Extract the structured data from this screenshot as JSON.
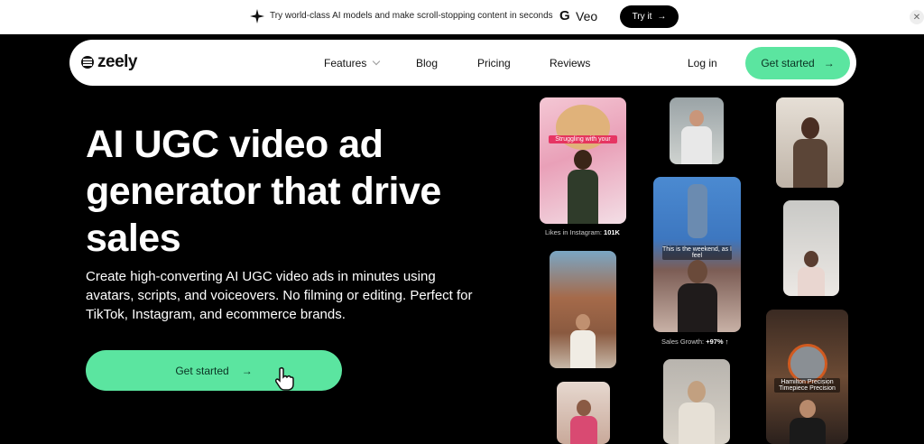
{
  "banner": {
    "text": "Try world-class AI models and make scroll-stopping content in seconds",
    "brand_g": "G",
    "brand_name": "Veo",
    "cta": "Try it"
  },
  "nav": {
    "logo": "zeely",
    "links": [
      "Features",
      "Blog",
      "Pricing",
      "Reviews"
    ],
    "login": "Log in",
    "cta": "Get started"
  },
  "hero": {
    "title": "AI UGC video ad generator that drive sales",
    "subtitle": "Create high-converting AI UGC video ads in minutes using avatars, scripts, and voiceovers. No filming or editing. Perfect for TikTok, Instagram, and ecommerce brands.",
    "cta": "Get started"
  },
  "gallery": {
    "card1_tag": "Struggling with your",
    "card1_caption_label": "Likes in Instagram:",
    "card1_caption_value": "101K",
    "card3_tag": "This is the weekend, as I feel",
    "card3_caption_label": "Sales Growth:",
    "card3_caption_value": "+97% ↑",
    "card7_tag": "Hamilton Precision Timepiece Precision"
  },
  "colors": {
    "accent": "#5be5a0",
    "background": "#000000"
  }
}
